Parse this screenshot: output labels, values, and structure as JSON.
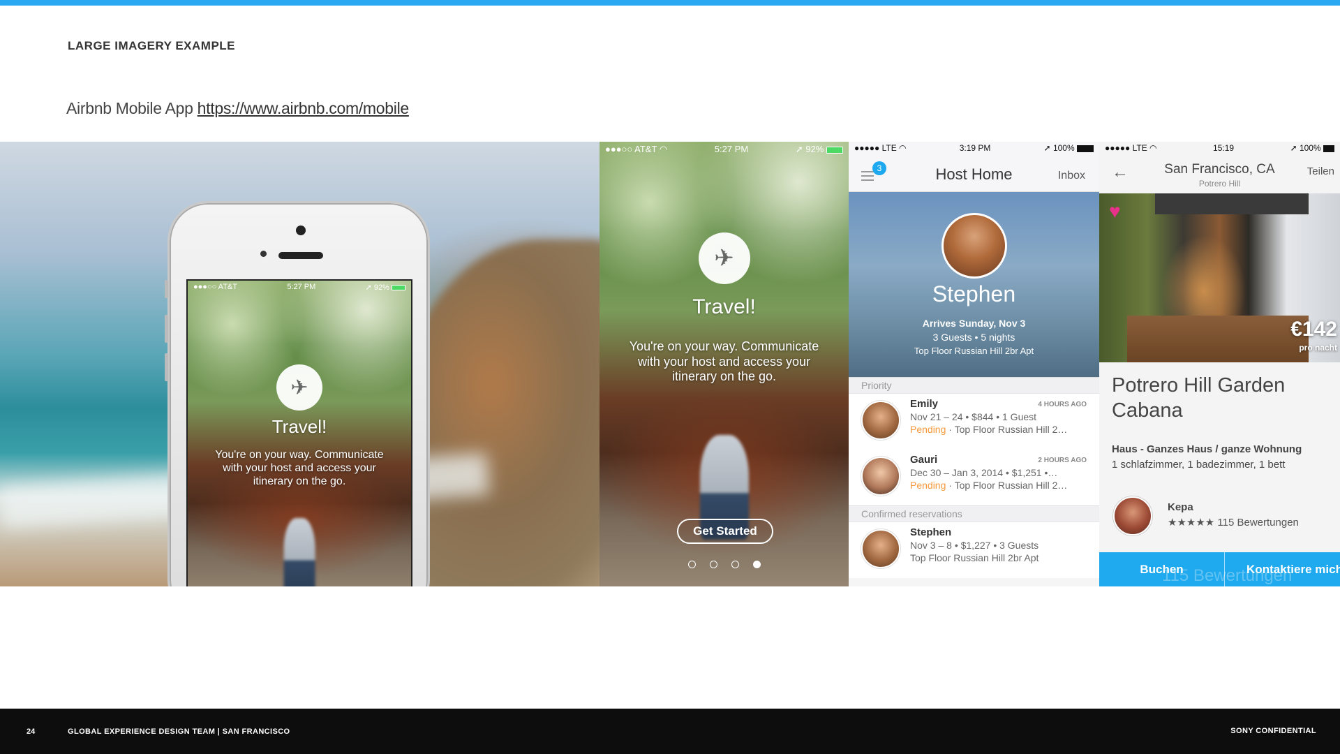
{
  "slide": {
    "title": "LARGE IMAGERY EXAMPLE",
    "subtitle_text": "Airbnb Mobile App ",
    "subtitle_link": "https://www.airbnb.com/mobile"
  },
  "footer": {
    "page_number": "24",
    "team": "GLOBAL EXPERIENCE DESIGN TEAM | SAN FRANCISCO",
    "confidential": "SONY CONFIDENTIAL"
  },
  "screen1": {
    "carrier": "●●●○○ AT&T",
    "time": "5:27 PM",
    "battery": "92%",
    "title": "Travel!",
    "body": "You're on your way. Communicate with your host and access your itinerary on the go."
  },
  "screen2": {
    "carrier": "●●●○○ AT&T",
    "time": "5:27 PM",
    "battery": "92%",
    "title": "Travel!",
    "body": "You're on your way. Communicate with your host and access your itinerary on the go.",
    "button": "Get Started",
    "page_indicator": {
      "total": 4,
      "active": 4
    }
  },
  "screen3": {
    "carrier": "●●●●● LTE",
    "time": "3:19 PM",
    "battery": "100%",
    "nav_title": "Host Home",
    "inbox": "Inbox",
    "badge": "3",
    "host_name": "Stephen",
    "arrives": "Arrives Sunday, Nov 3",
    "guests": "3 Guests  •  5 nights",
    "apartment": "Top Floor Russian Hill 2br Apt",
    "priority_label": "Priority",
    "confirmed_label": "Confirmed reservations",
    "rows": [
      {
        "name": "Emily",
        "time": "4 HOURS AGO",
        "line1": "Nov 21 – 24 • $844 • 1 Guest",
        "status": "Pending",
        "line2": " · Top Floor Russian Hill 2…"
      },
      {
        "name": "Gauri",
        "time": "2 HOURS AGO",
        "line1": "Dec 30 – Jan 3, 2014 • $1,251 •…",
        "status": "Pending",
        "line2": " · Top Floor Russian Hill 2…"
      },
      {
        "name": "Stephen",
        "time": "",
        "line1": "Nov 3 – 8 • $1,227 • 3 Guests",
        "status": "",
        "line2": "Top Floor Russian Hill 2br Apt"
      }
    ]
  },
  "screen4": {
    "carrier": "●●●●● LTE",
    "time": "15:19",
    "battery": "100%",
    "city": "San Francisco, CA",
    "neighborhood": "Potrero Hill",
    "share": "Teilen",
    "price": "€142",
    "per_night": "pro nacht",
    "listing_name": "Potrero Hill Garden Cabana",
    "type": "Haus - Ganzes Haus / ganze Wohnung",
    "rooms": "1 schlafzimmer, 1 badezimmer, 1 bett",
    "host": "Kepa",
    "reviews": "★★★★★ 115 Bewertungen",
    "book": "Buchen",
    "contact": "Kontaktiere mich",
    "ghost_text": "115 Bewertungen"
  },
  "colors": {
    "accent": "#2aa8f2",
    "airbnb_blue": "#1fa9ee",
    "pending": "#f5993b",
    "favorite": "#e7318a",
    "footer_bg": "#0d0d0d"
  },
  "icons": [
    "airplane-icon",
    "wifi-icon",
    "battery-icon",
    "menu-icon",
    "back-arrow-icon",
    "heart-icon",
    "star-icon",
    "location-arrow-icon"
  ]
}
